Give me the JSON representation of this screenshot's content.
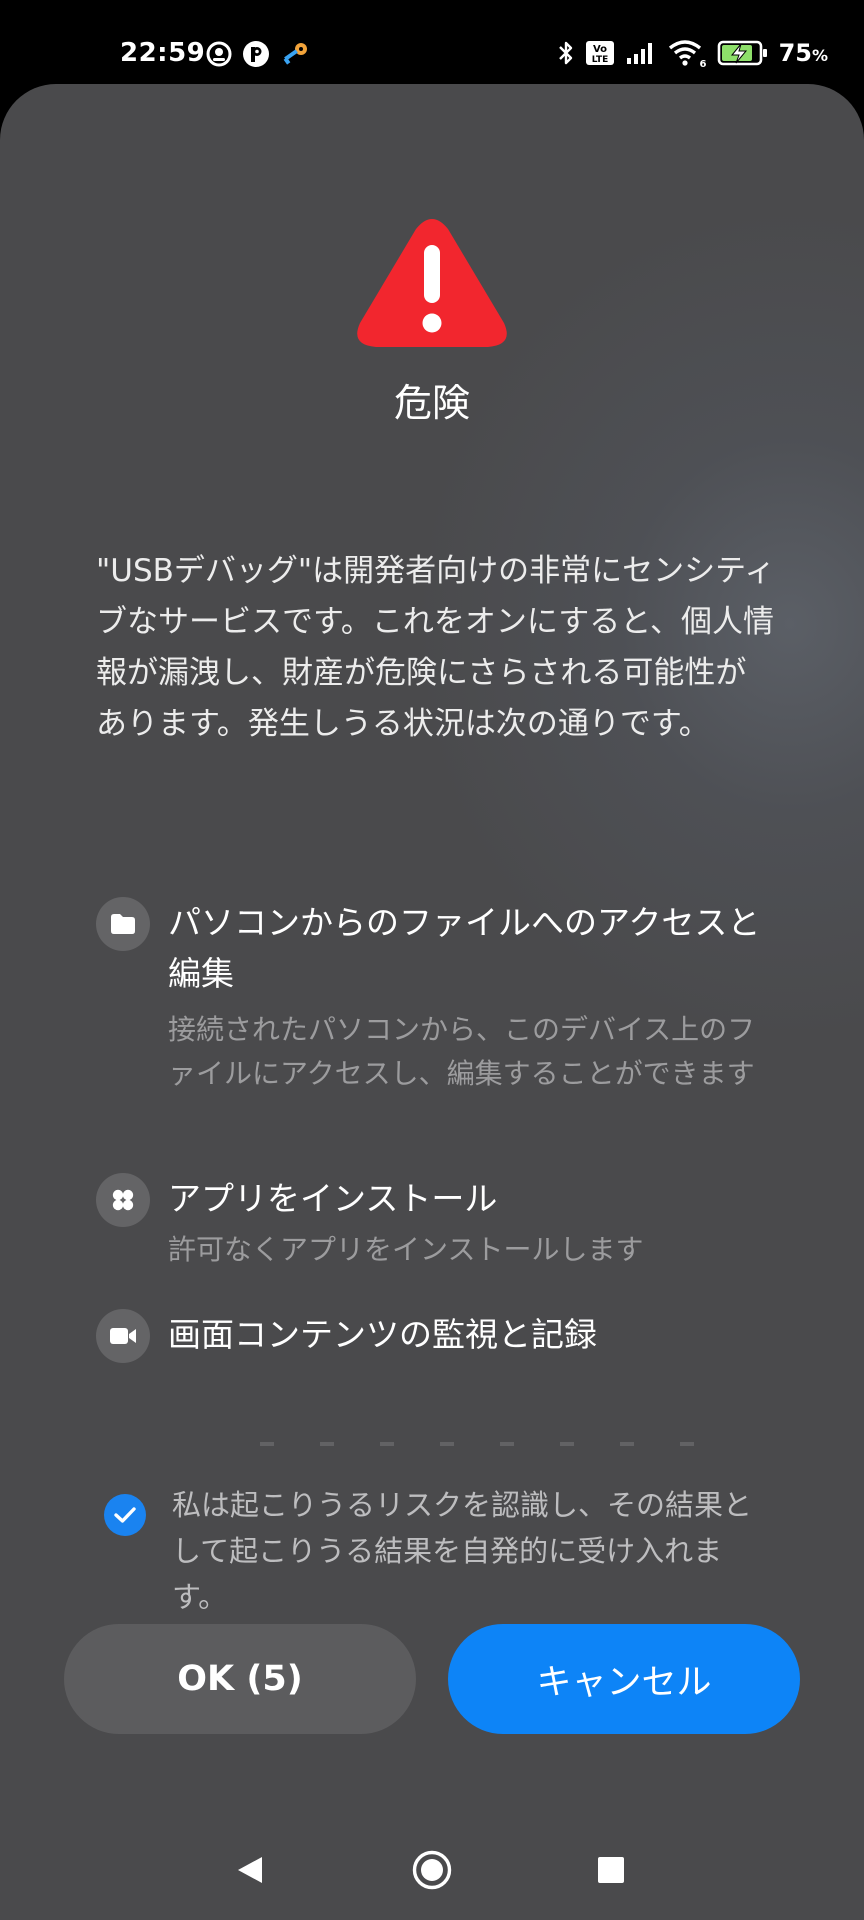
{
  "status_bar": {
    "time": "22:59",
    "battery_percent": "75",
    "battery_unit": "%",
    "network_label_top": "Vo",
    "network_label_bottom": "LTE",
    "wifi_badge": "6"
  },
  "dialog": {
    "title": "危険",
    "description": "\"USBデバッグ\"は開発者向けの非常にセンシティブなサービスです。これをオンにすると、個人情報が漏洩し、財産が危険にさらされる可能性があります。発生しうる状況は次の通りです。",
    "risks": [
      {
        "icon": "folder-icon",
        "title": "パソコンからのファイルへのアクセスと編集",
        "desc": "接続されたパソコンから、このデバイス上のファイルにアクセスし、編集することができます"
      },
      {
        "icon": "apps-icon",
        "title": "アプリをインストール",
        "desc": "許可なくアプリをインストールします"
      },
      {
        "icon": "video-camera-icon",
        "title": "画面コンテンツの監視と記録",
        "desc": ""
      }
    ],
    "consent_text": "私は起こりうるリスクを認識し、その結果として起こりうる結果を自発的に受け入れます。",
    "consent_checked": true,
    "ok_label": "OK (5)",
    "cancel_label": "キャンセル"
  },
  "colors": {
    "warning_red": "#f2262e",
    "accent_blue": "#0d84f7",
    "checkbox_blue": "#1a83f0"
  }
}
